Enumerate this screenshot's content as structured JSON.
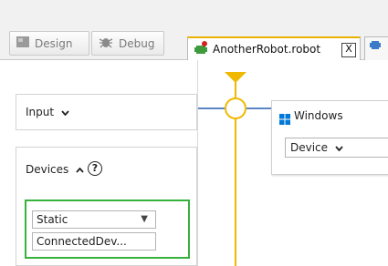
{
  "toolbar": {
    "design_label": "Design",
    "debug_label": "Debug"
  },
  "tabs": [
    {
      "label": "AnotherRobot.robot",
      "close": "X"
    },
    {
      "label": ""
    }
  ],
  "palette": {
    "input_label": "Input",
    "devices_label": "Devices",
    "devices_help": "?",
    "static_value": "Static",
    "connected_value": "ConnectedDev..."
  },
  "canvas": {
    "windows_title": "Windows",
    "device_label": "Device"
  },
  "colors": {
    "accent_yellow": "#f0b800",
    "flow_blue": "#5b86c6",
    "highlight_green": "#36b23c",
    "windows_blue": "#0078d7"
  },
  "icons": [
    "design-icon",
    "debug-icon",
    "robot-icon",
    "close-icon",
    "chevron-down-icon",
    "chevron-up-icon",
    "help-icon",
    "windows-icon",
    "dropdown-arrow-icon"
  ]
}
